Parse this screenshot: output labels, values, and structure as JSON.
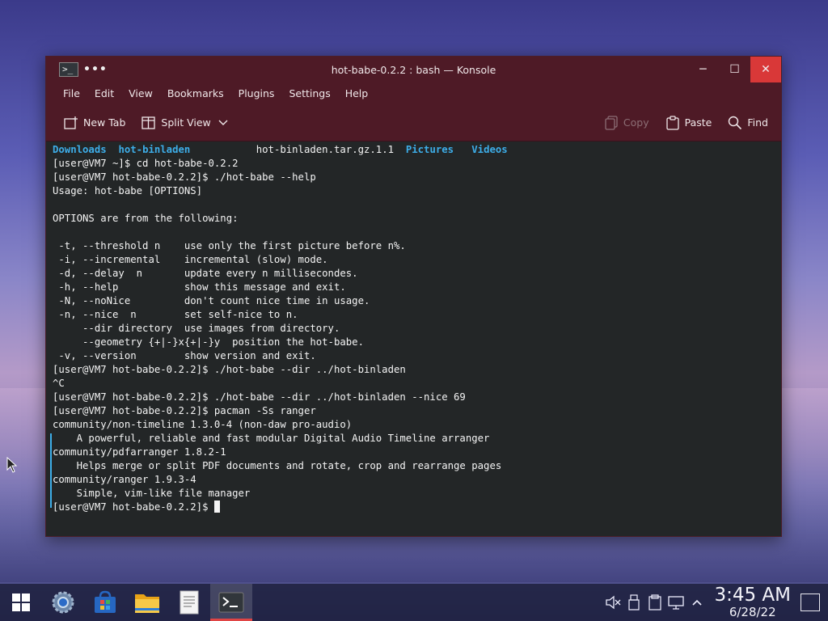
{
  "window": {
    "title": "hot-babe-0.2.2 : bash — Konsole",
    "controls": {
      "minimize": "─",
      "maximize": "☐",
      "close": "✕"
    }
  },
  "menu": [
    "File",
    "Edit",
    "View",
    "Bookmarks",
    "Plugins",
    "Settings",
    "Help"
  ],
  "toolbar": {
    "new_tab": "New Tab",
    "split_view": "Split View",
    "copy": "Copy",
    "paste": "Paste",
    "find": "Find"
  },
  "terminal": {
    "ls_line": {
      "dir1": "Downloads",
      "dir2": "hot-binladen",
      "file1": "hot-binladen.tar.gz.1.1",
      "dir3": "Pictures",
      "dir4": "Videos"
    },
    "lines": [
      "[user@VM7 ~]$ cd hot-babe-0.2.2",
      "[user@VM7 hot-babe-0.2.2]$ ./hot-babe --help",
      "Usage: hot-babe [OPTIONS]",
      "",
      "OPTIONS are from the following:",
      "",
      " -t, --threshold n    use only the first picture before n%.",
      " -i, --incremental    incremental (slow) mode.",
      " -d, --delay  n       update every n millisecondes.",
      " -h, --help           show this message and exit.",
      " -N, --noNice         don't count nice time in usage.",
      " -n, --nice  n        set self-nice to n.",
      "     --dir directory  use images from directory.",
      "     --geometry {+|-}x{+|-}y  position the hot-babe.",
      " -v, --version        show version and exit.",
      "[user@VM7 hot-babe-0.2.2]$ ./hot-babe --dir ../hot-binladen",
      "^C",
      "[user@VM7 hot-babe-0.2.2]$ ./hot-babe --dir ../hot-binladen --nice 69",
      "[user@VM7 hot-babe-0.2.2]$ pacman -Ss ranger",
      "community/non-timeline 1.3.0-4 (non-daw pro-audio)",
      "    A powerful, reliable and fast modular Digital Audio Timeline arranger",
      "community/pdfarranger 1.8.2-1",
      "    Helps merge or split PDF documents and rotate, crop and rearrange pages",
      "community/ranger 1.9.3-4",
      "    Simple, vim-like file manager"
    ],
    "prompt": "[user@VM7 hot-babe-0.2.2]$ "
  },
  "taskbar": {
    "clock_time": "3:45 AM",
    "clock_date": "6/28/22"
  },
  "colors": {
    "titlebar": "#4e1a26",
    "terminal_bg": "#232627",
    "dir_blue": "#3daee9"
  }
}
